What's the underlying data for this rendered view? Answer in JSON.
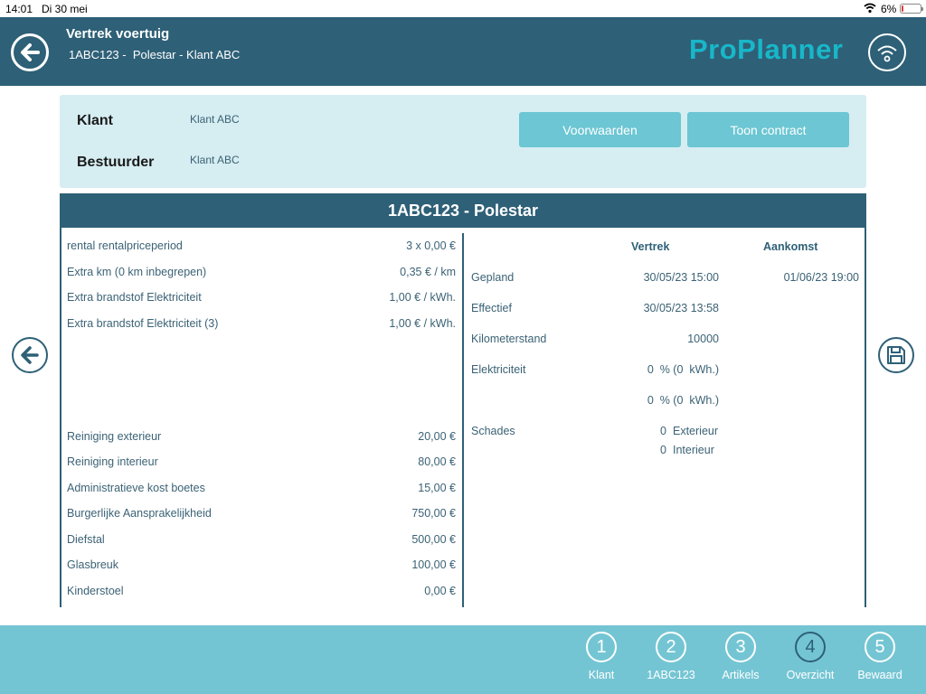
{
  "status": {
    "time": "14:01",
    "date": "Di 30 mei",
    "battery": "6%"
  },
  "header": {
    "title": "Vertrek voertuig",
    "subtitle": "1ABC123 -  Polestar - Klant ABC",
    "logo": "ProPlanner"
  },
  "client": {
    "klant_label": "Klant",
    "klant_value": "Klant ABC",
    "bestuurder_label": "Bestuurder",
    "bestuurder_value": "Klant ABC",
    "btn_voorwaarden": "Voorwaarden",
    "btn_contract": "Toon contract"
  },
  "vehicle": {
    "title": "1ABC123 - Polestar"
  },
  "pricing_top": [
    {
      "label": "rental rentalpriceperiod",
      "value": "3 x 0,00 €"
    },
    {
      "label": "Extra km (0 km inbegrepen)",
      "value": "0,35 € / km"
    },
    {
      "label": "Extra brandstof  Elektriciteit",
      "value": "1,00 € / kWh."
    },
    {
      "label": "Extra brandstof  Elektriciteit (3)",
      "value": "1,00 € / kWh."
    }
  ],
  "pricing_bottom": [
    {
      "label": "Reiniging exterieur",
      "value": "20,00 €"
    },
    {
      "label": "Reiniging interieur",
      "value": "80,00 €"
    },
    {
      "label": "Administratieve kost boetes",
      "value": "15,00 €"
    },
    {
      "label": "Burgerlijke Aansprakelijkheid",
      "value": "750,00 €"
    },
    {
      "label": "Diefstal",
      "value": "500,00 €"
    },
    {
      "label": "Glasbreuk",
      "value": "100,00 €"
    },
    {
      "label": "Kinderstoel",
      "value": "0,00 €"
    }
  ],
  "details": {
    "col_vertrek": "Vertrek",
    "col_aankomst": "Aankomst",
    "gepland_label": "Gepland",
    "gepland_vertrek": "30/05/23 15:00",
    "gepland_aankomst": "01/06/23 19:00",
    "effectief_label": "Effectief",
    "effectief_vertrek": "30/05/23 13:58",
    "km_label": "Kilometerstand",
    "km_value": "10000",
    "elek_label": "Elektriciteit",
    "elek_value_1": "0  % (0  kWh.)",
    "elek_value_2": "0  % (0  kWh.)",
    "schades_label": "Schades",
    "schade_ext_count": "0",
    "schade_ext_label": "Exterieur",
    "schade_int_count": "0",
    "schade_int_label": "Interieur"
  },
  "steps": [
    {
      "num": "1",
      "label": "Klant"
    },
    {
      "num": "2",
      "label": "1ABC123"
    },
    {
      "num": "3",
      "label": "Artikels"
    },
    {
      "num": "4",
      "label": "Overzicht"
    },
    {
      "num": "5",
      "label": "Bewaard"
    }
  ],
  "active_step": "4",
  "colors": {
    "header": "#2e6077",
    "accent": "#18b7c9",
    "button": "#6cc6d3",
    "card": "#d6edf2",
    "steps_bar": "#74c5d3"
  }
}
